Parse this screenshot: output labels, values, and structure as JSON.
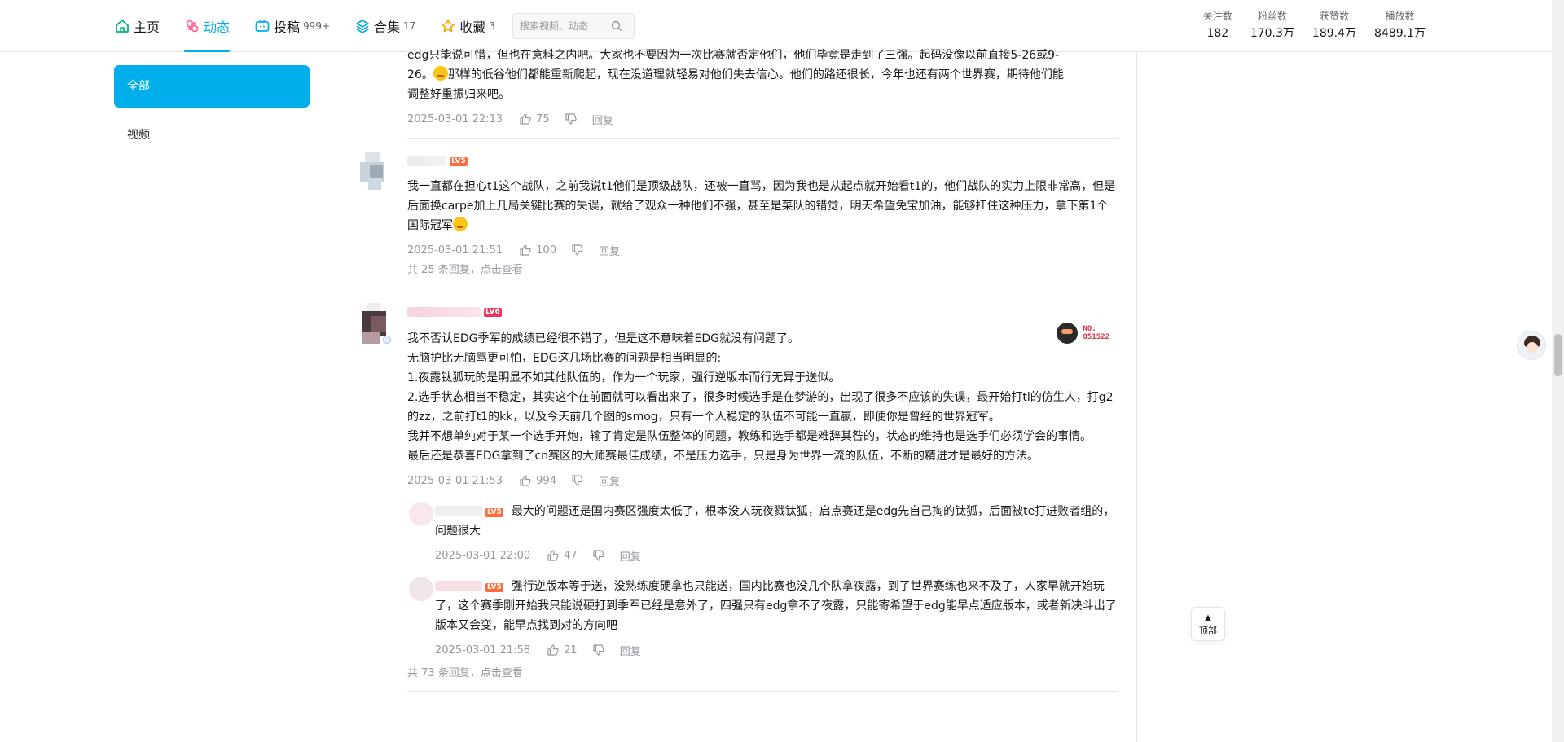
{
  "nav": {
    "items": [
      {
        "label": "主页",
        "count": "",
        "icon": "home-icon"
      },
      {
        "label": "动态",
        "count": "",
        "icon": "dynamic-icon",
        "active": true
      },
      {
        "label": "投稿",
        "count": "999+",
        "icon": "upload-icon"
      },
      {
        "label": "合集",
        "count": "17",
        "icon": "collection-icon"
      },
      {
        "label": "收藏",
        "count": "3",
        "icon": "favorite-icon"
      }
    ],
    "search_placeholder": "搜索视频、动态"
  },
  "stats": [
    {
      "label": "关注数",
      "value": "182"
    },
    {
      "label": "粉丝数",
      "value": "170.3万"
    },
    {
      "label": "获赞数",
      "value": "189.4万"
    },
    {
      "label": "播放数",
      "value": "8489.1万"
    }
  ],
  "sidebar": {
    "items": [
      {
        "label": "全部",
        "active": true
      },
      {
        "label": "视频",
        "active": false
      }
    ]
  },
  "comments": {
    "first": {
      "text_line1": "edg只能说可惜，但也在意料之内吧。大家也不要因为一次比赛就否定他们，他们毕竟是走到了三强。起码没像以前直接5-26或9-",
      "text_line2a": "26。",
      "text_line2b": "那样的低谷他们都能重新爬起，现在没道理就轻易对他们失去信心。他们的路还很长，今年也还有两个世界赛，期待他们能",
      "text_line3": "调整好重振归来吧。",
      "time": "2025-03-01 22:13",
      "likes": "75",
      "reply": "回复"
    },
    "second": {
      "level": "LV5",
      "text": "我一直都在担心t1这个战队，之前我说t1他们是顶级战队，还被一直骂，因为我也是从起点就开始看t1的，他们战队的实力上限非常高，但是后面换carpe加上几局关键比赛的失误，就给了观众一种他们不强，甚至是菜队的错觉，明天希望免宝加油，能够扛住这种压力，拿下第1个国际冠军",
      "time": "2025-03-01 21:51",
      "likes": "100",
      "reply": "回复",
      "more": "共 25 条回复，点击查看"
    },
    "third": {
      "level": "LV6",
      "badge_no": "NO.",
      "badge_num": "051522",
      "lines": [
        "我不否认EDG季军的成绩已经很不错了，但是这不意味着EDG就没有问题了。",
        "无脑护比无脑骂更可怕，EDG这几场比赛的问题是相当明显的:",
        "1.夜露钛狐玩的是明显不如其他队伍的，作为一个玩家，强行逆版本而行无异于送似。",
        "2.选手状态相当不稳定，其实这个在前面就可以看出来了，很多时候选手是在梦游的，出现了很多不应该的失误，最开始打tl的仿生人，打g2的zz，之前打t1的kk，以及今天前几个图的smog，只有一个人稳定的队伍不可能一直赢，即便你是曾经的世界冠军。",
        "我并不想单纯对于某一个选手开炮，输了肯定是队伍整体的问题，教练和选手都是难辞其咎的，状态的维持也是选手们必须学会的事情。",
        "最后还是恭喜EDG拿到了cn赛区的大师赛最佳成绩，不是压力选手，只是身为世界一流的队伍，不断的精进才是最好的方法。"
      ],
      "time": "2025-03-01 21:53",
      "likes": "994",
      "reply": "回复",
      "replies": [
        {
          "level": "LV5",
          "text": "最大的问题还是国内赛区强度太低了，根本没人玩夜戮钛狐，启点赛还是edg先自己掏的钛狐，后面被te打进败者组的，问题很大",
          "time": "2025-03-01 22:00",
          "likes": "47",
          "reply": "回复"
        },
        {
          "level": "LV5",
          "text": "强行逆版本等于送，没熟练度硬拿也只能送，国内比赛也没几个队拿夜露，到了世界赛练也来不及了，人家早就开始玩了，这个赛季刚开始我只能说硬打到季军已经是意外了，四强只有edg拿不了夜露，只能寄希望于edg能早点适应版本，或者新决斗出了版本又会变，能早点找到对的方向吧",
          "time": "2025-03-01 21:58",
          "likes": "21",
          "reply": "回复"
        }
      ],
      "more": "共 73 条回复，点击查看"
    }
  },
  "totop_label": "顶部",
  "colors": {
    "accent": "#00aeec",
    "meta": "#9499a0",
    "level": "#ff6b3b"
  }
}
